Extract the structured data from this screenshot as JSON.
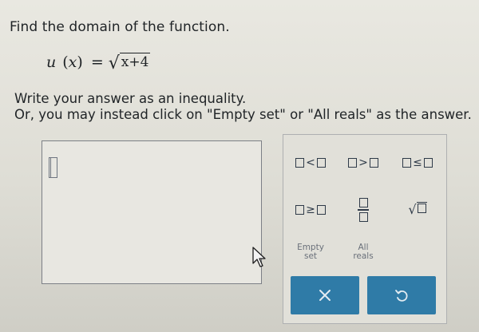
{
  "prompt": "Find the domain of the function.",
  "function": {
    "name": "u",
    "variable": "x",
    "equals": "=",
    "radicand": "x+4"
  },
  "instructions": {
    "line1": "Write your answer as an inequality.",
    "line2": "Or, you may instead click on \"Empty set\" or \"All reals\" as the answer."
  },
  "keypad": {
    "less_than": "<",
    "greater_than": ">",
    "less_equal": "≤",
    "greater_equal": "≥",
    "empty_set": [
      "Empty",
      "set"
    ],
    "all_reals": [
      "All",
      "reals"
    ],
    "sqrt_symbol": "√"
  },
  "icons": {
    "clear": "close-icon",
    "undo": "undo-icon",
    "pointer": "cursor-pointer-icon"
  },
  "colors": {
    "button": "#2f7ba7",
    "keypad_symbol": "#2e3a48"
  }
}
